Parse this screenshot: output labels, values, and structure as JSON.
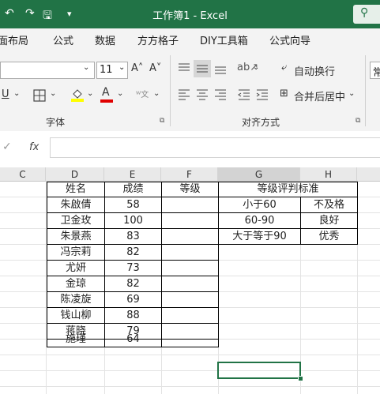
{
  "window": {
    "title": "工作簿1  -  Excel"
  },
  "quick_access": {
    "undo": "↶",
    "redo": "↷",
    "save": "🖫",
    "more": "▾"
  },
  "menu": [
    "面布局",
    "公式",
    "数据",
    "方方格子",
    "DIY工具箱",
    "公式向导"
  ],
  "ribbon": {
    "font_size": "11",
    "grow_font": "A˄",
    "shrink_font": "A˅",
    "underline": "U",
    "wrap_text": "自动换行",
    "merge_center": "合并后居中",
    "number_format_partial": "常",
    "font_group_label": "字体",
    "align_group_label": "对齐方式"
  },
  "formula_bar": {
    "fx": "fx",
    "value": ""
  },
  "columns": [
    "C",
    "D",
    "E",
    "F",
    "G",
    "H"
  ],
  "table": {
    "headers": {
      "name": "姓名",
      "score": "成绩",
      "grade": "等级"
    },
    "rows": [
      {
        "name": "朱啟倩",
        "score": "58"
      },
      {
        "name": "卫金玫",
        "score": "100"
      },
      {
        "name": "朱景燕",
        "score": "83"
      },
      {
        "name": "冯宗莉",
        "score": "82"
      },
      {
        "name": "尤妍",
        "score": "73"
      },
      {
        "name": "金琼",
        "score": "82"
      },
      {
        "name": "陈凌旋",
        "score": "69"
      },
      {
        "name": "钱山柳",
        "score": "88"
      },
      {
        "name": "蒋晓",
        "score": "79"
      },
      {
        "name": "施瑾",
        "score": "64"
      }
    ]
  },
  "criteria": {
    "title": "等级评判标准",
    "rows": [
      {
        "range": "小于60",
        "grade": "不及格"
      },
      {
        "range": "60-90",
        "grade": "良好"
      },
      {
        "range": "大于等于90",
        "grade": "优秀"
      }
    ]
  },
  "colors": {
    "excel_green": "#217346",
    "font_color": "#e00000",
    "highlight": "#ffff00"
  }
}
